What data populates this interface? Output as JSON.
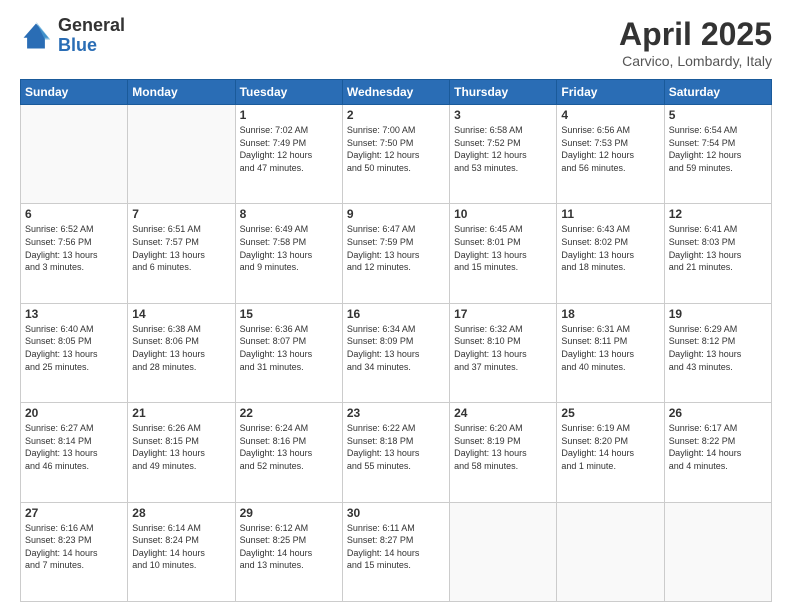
{
  "header": {
    "logo_general": "General",
    "logo_blue": "Blue",
    "month_title": "April 2025",
    "location": "Carvico, Lombardy, Italy"
  },
  "weekdays": [
    "Sunday",
    "Monday",
    "Tuesday",
    "Wednesday",
    "Thursday",
    "Friday",
    "Saturday"
  ],
  "weeks": [
    [
      {
        "day": "",
        "info": ""
      },
      {
        "day": "",
        "info": ""
      },
      {
        "day": "1",
        "info": "Sunrise: 7:02 AM\nSunset: 7:49 PM\nDaylight: 12 hours\nand 47 minutes."
      },
      {
        "day": "2",
        "info": "Sunrise: 7:00 AM\nSunset: 7:50 PM\nDaylight: 12 hours\nand 50 minutes."
      },
      {
        "day": "3",
        "info": "Sunrise: 6:58 AM\nSunset: 7:52 PM\nDaylight: 12 hours\nand 53 minutes."
      },
      {
        "day": "4",
        "info": "Sunrise: 6:56 AM\nSunset: 7:53 PM\nDaylight: 12 hours\nand 56 minutes."
      },
      {
        "day": "5",
        "info": "Sunrise: 6:54 AM\nSunset: 7:54 PM\nDaylight: 12 hours\nand 59 minutes."
      }
    ],
    [
      {
        "day": "6",
        "info": "Sunrise: 6:52 AM\nSunset: 7:56 PM\nDaylight: 13 hours\nand 3 minutes."
      },
      {
        "day": "7",
        "info": "Sunrise: 6:51 AM\nSunset: 7:57 PM\nDaylight: 13 hours\nand 6 minutes."
      },
      {
        "day": "8",
        "info": "Sunrise: 6:49 AM\nSunset: 7:58 PM\nDaylight: 13 hours\nand 9 minutes."
      },
      {
        "day": "9",
        "info": "Sunrise: 6:47 AM\nSunset: 7:59 PM\nDaylight: 13 hours\nand 12 minutes."
      },
      {
        "day": "10",
        "info": "Sunrise: 6:45 AM\nSunset: 8:01 PM\nDaylight: 13 hours\nand 15 minutes."
      },
      {
        "day": "11",
        "info": "Sunrise: 6:43 AM\nSunset: 8:02 PM\nDaylight: 13 hours\nand 18 minutes."
      },
      {
        "day": "12",
        "info": "Sunrise: 6:41 AM\nSunset: 8:03 PM\nDaylight: 13 hours\nand 21 minutes."
      }
    ],
    [
      {
        "day": "13",
        "info": "Sunrise: 6:40 AM\nSunset: 8:05 PM\nDaylight: 13 hours\nand 25 minutes."
      },
      {
        "day": "14",
        "info": "Sunrise: 6:38 AM\nSunset: 8:06 PM\nDaylight: 13 hours\nand 28 minutes."
      },
      {
        "day": "15",
        "info": "Sunrise: 6:36 AM\nSunset: 8:07 PM\nDaylight: 13 hours\nand 31 minutes."
      },
      {
        "day": "16",
        "info": "Sunrise: 6:34 AM\nSunset: 8:09 PM\nDaylight: 13 hours\nand 34 minutes."
      },
      {
        "day": "17",
        "info": "Sunrise: 6:32 AM\nSunset: 8:10 PM\nDaylight: 13 hours\nand 37 minutes."
      },
      {
        "day": "18",
        "info": "Sunrise: 6:31 AM\nSunset: 8:11 PM\nDaylight: 13 hours\nand 40 minutes."
      },
      {
        "day": "19",
        "info": "Sunrise: 6:29 AM\nSunset: 8:12 PM\nDaylight: 13 hours\nand 43 minutes."
      }
    ],
    [
      {
        "day": "20",
        "info": "Sunrise: 6:27 AM\nSunset: 8:14 PM\nDaylight: 13 hours\nand 46 minutes."
      },
      {
        "day": "21",
        "info": "Sunrise: 6:26 AM\nSunset: 8:15 PM\nDaylight: 13 hours\nand 49 minutes."
      },
      {
        "day": "22",
        "info": "Sunrise: 6:24 AM\nSunset: 8:16 PM\nDaylight: 13 hours\nand 52 minutes."
      },
      {
        "day": "23",
        "info": "Sunrise: 6:22 AM\nSunset: 8:18 PM\nDaylight: 13 hours\nand 55 minutes."
      },
      {
        "day": "24",
        "info": "Sunrise: 6:20 AM\nSunset: 8:19 PM\nDaylight: 13 hours\nand 58 minutes."
      },
      {
        "day": "25",
        "info": "Sunrise: 6:19 AM\nSunset: 8:20 PM\nDaylight: 14 hours\nand 1 minute."
      },
      {
        "day": "26",
        "info": "Sunrise: 6:17 AM\nSunset: 8:22 PM\nDaylight: 14 hours\nand 4 minutes."
      }
    ],
    [
      {
        "day": "27",
        "info": "Sunrise: 6:16 AM\nSunset: 8:23 PM\nDaylight: 14 hours\nand 7 minutes."
      },
      {
        "day": "28",
        "info": "Sunrise: 6:14 AM\nSunset: 8:24 PM\nDaylight: 14 hours\nand 10 minutes."
      },
      {
        "day": "29",
        "info": "Sunrise: 6:12 AM\nSunset: 8:25 PM\nDaylight: 14 hours\nand 13 minutes."
      },
      {
        "day": "30",
        "info": "Sunrise: 6:11 AM\nSunset: 8:27 PM\nDaylight: 14 hours\nand 15 minutes."
      },
      {
        "day": "",
        "info": ""
      },
      {
        "day": "",
        "info": ""
      },
      {
        "day": "",
        "info": ""
      }
    ]
  ]
}
